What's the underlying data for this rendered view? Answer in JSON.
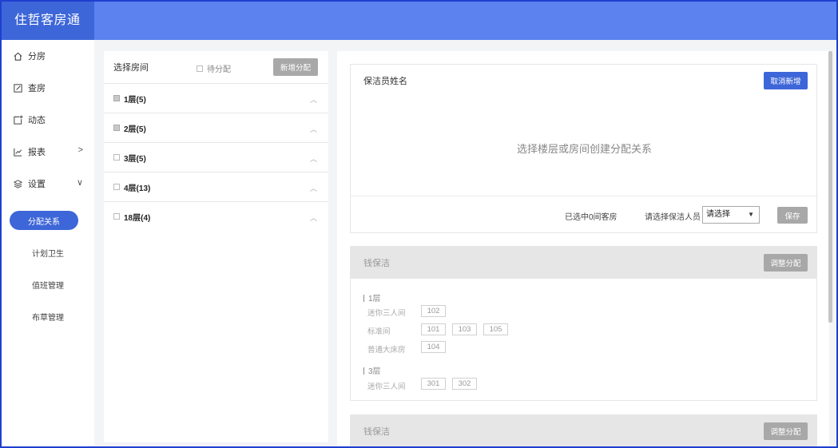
{
  "app": {
    "title": "住哲客房通"
  },
  "sidebar": {
    "items": [
      {
        "label": "分房",
        "icon": "home-icon"
      },
      {
        "label": "查房",
        "icon": "edit-icon"
      },
      {
        "label": "动态",
        "icon": "notification-icon"
      },
      {
        "label": "报表",
        "icon": "chart-icon",
        "chevron": ">"
      },
      {
        "label": "设置",
        "icon": "layers-icon",
        "chevron": "∨"
      }
    ],
    "sub_items": [
      {
        "label": "分配关系",
        "active": true
      },
      {
        "label": "计划卫生",
        "active": false
      },
      {
        "label": "值班管理",
        "active": false
      },
      {
        "label": "布草管理",
        "active": false
      }
    ]
  },
  "room_panel": {
    "title": "选择房间",
    "pending_label": "待分配",
    "add_button": "新增分配",
    "floors": [
      {
        "label": "1层(5)",
        "checked": true
      },
      {
        "label": "2层(5)",
        "checked": true
      },
      {
        "label": "3层(5)",
        "checked": false
      },
      {
        "label": "4层(13)",
        "checked": false
      },
      {
        "label": "18层(4)",
        "checked": false
      }
    ]
  },
  "new_assignment": {
    "title": "保洁员姓名",
    "cancel_button": "取消新增",
    "hint": "选择楼层或房间创建分配关系",
    "selected_text": "已选中0间客房",
    "cleaner_label": "请选择保洁人员",
    "cleaner_select": "请选择",
    "save_button": "保存"
  },
  "assignments": [
    {
      "name": "钱保洁",
      "adjust_button": "调整分配",
      "floors": [
        {
          "title": "1层",
          "types": [
            {
              "name": "迷你三人间",
              "rooms": [
                "102"
              ]
            },
            {
              "name": "标准间",
              "rooms": [
                "101",
                "103",
                "105"
              ]
            },
            {
              "name": "普通大床房",
              "rooms": [
                "104"
              ]
            }
          ]
        },
        {
          "title": "3层",
          "types": [
            {
              "name": "迷你三人间",
              "rooms": [
                "301",
                "302"
              ]
            }
          ]
        }
      ]
    },
    {
      "name": "钱保洁",
      "adjust_button": "调整分配"
    }
  ],
  "colors": {
    "header": "#5b82ee",
    "brand": "#3d66d8",
    "primary": "#3d66d8",
    "disabled": "#a8a8a8"
  }
}
